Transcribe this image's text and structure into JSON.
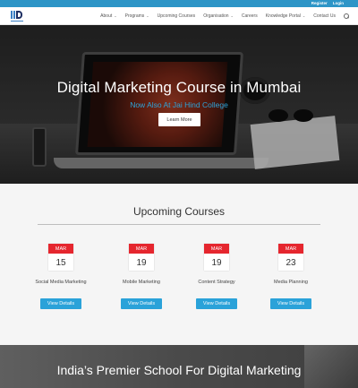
{
  "topbar": {
    "register_label": "Register",
    "login_label": "Login"
  },
  "nav": {
    "items": [
      {
        "label": "About",
        "has_dropdown": true
      },
      {
        "label": "Programs",
        "has_dropdown": true
      },
      {
        "label": "Upcoming Courses",
        "has_dropdown": false
      },
      {
        "label": "Organisation",
        "has_dropdown": true
      },
      {
        "label": "Careers",
        "has_dropdown": false
      },
      {
        "label": "Knowledge Portal",
        "has_dropdown": true
      },
      {
        "label": "Contact Us",
        "has_dropdown": false
      }
    ],
    "search_icon": "search-icon"
  },
  "hero": {
    "title": "Digital Marketing Course in Mumbai",
    "subtitle": "Now Also At Jai Hind College",
    "button_label": "Learn More"
  },
  "courses": {
    "title": "Upcoming Courses",
    "items": [
      {
        "month": "MAR",
        "day": "15",
        "name": "Social Media Marketing",
        "button": "View Details"
      },
      {
        "month": "MAR",
        "day": "19",
        "name": "Mobile Marketing",
        "button": "View Details"
      },
      {
        "month": "MAR",
        "day": "19",
        "name": "Content Strategy",
        "button": "View Details"
      },
      {
        "month": "MAR",
        "day": "23",
        "name": "Media Planning",
        "button": "View Details"
      }
    ]
  },
  "banner": {
    "title": "India’s Premier School For Digital Marketing"
  },
  "colors": {
    "accent_blue": "#2aa2d9",
    "topbar_blue": "#2d95c7",
    "calendar_red": "#e5262e"
  }
}
